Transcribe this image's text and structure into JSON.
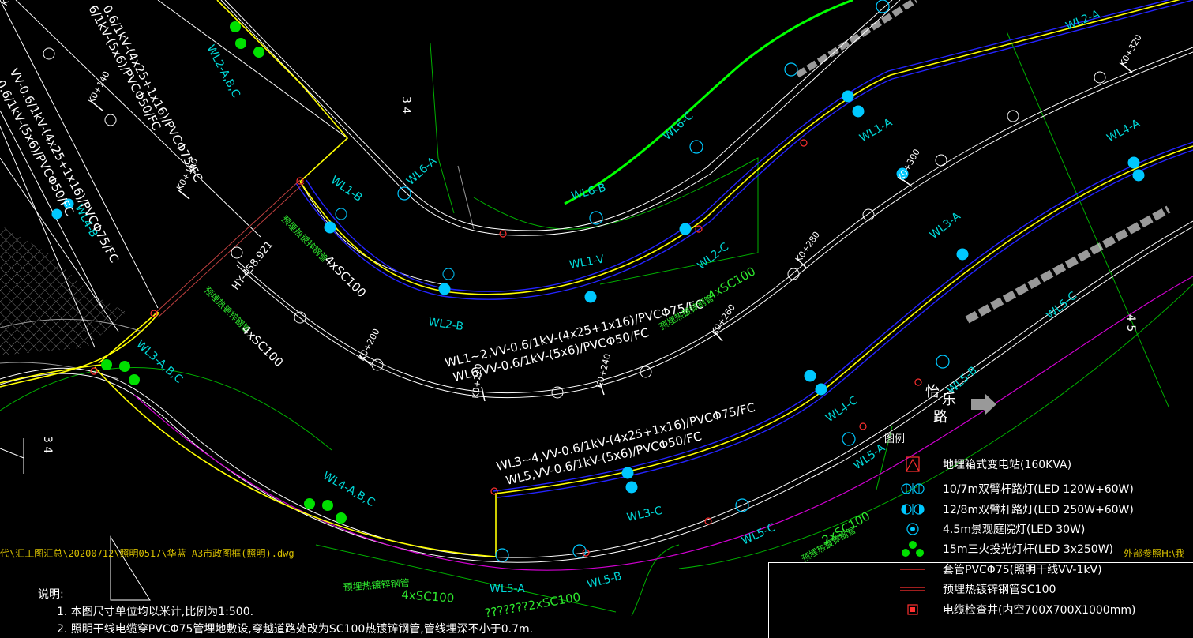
{
  "drawing": {
    "file_path": "代\\汇工图汇总\\20200712\\照明0517\\华蓝 A3市政图框(照明).dwg",
    "external_ref": "外部参照H:\\我",
    "road_name": "怡乐路",
    "road_chars": [
      "怡",
      "乐",
      "路"
    ],
    "colors": {
      "background": "#000000",
      "road_edge": "#ffffff",
      "cable_yellow": "#ffff00",
      "cable_blue": "#2020ff",
      "cable_green": "#00ff00",
      "magenta": "#d000d0",
      "label_cyan": "#00d8d8",
      "label_gold": "#d8c000",
      "boundary_green": "#00c000"
    },
    "circuit_labels": [
      "WL6-A",
      "WL6-B",
      "WL6-C",
      "WL2-A",
      "WL1-A",
      "WL4-A",
      "WL2-A,B,C",
      "WL1-B",
      "WL1-V",
      "WL2-B",
      "WL2-C",
      "WL3-A",
      "WL4-B",
      "WL3-A,B,C",
      "WL4-C",
      "WL5-B",
      "WL5-C",
      "WL4-A,B,C",
      "WL3-C",
      "WL5-A",
      "WL5-B",
      "WL5-C",
      "WL5-A"
    ],
    "cable_specs": [
      "0.6/1kV-(4x25+1x16)/PVCΦ75/FC",
      "6/1kV-(5x6)/PVCΦ50/FC",
      "VV-0.6/1kV-(4x25+1x16)/PVCΦ75/FC",
      "0.6/1kV-(5x6)/PVCΦ50/FC",
      "WL1~2,VV-0.6/1kV-(4x25+1x16)/PVCΦ75/FC",
      "WL6,VV-0.6/1kV-(5x6)/PVCΦ50/FC",
      "WL3~4,VV-0.6/1kV-(4x25+1x16)/PVCΦ75/FC",
      "WL5,VV-0.6/1kV-(5x6)/PVCΦ50/FC"
    ],
    "conduit_specs": [
      "预埋热镀锌钢管4xSC100",
      "预埋热镀锌钢管4xSC100",
      "预埋热镀锌钢管4xSC100",
      "???????2xSC100",
      "预埋热镀锌钢管2xSC100",
      "预埋热镀锌钢管2xSC100",
      "预埋热镀锌钢管4xSC100"
    ],
    "conduit_short": [
      "4xSC100",
      "4xSC100",
      "4xSC100",
      "2xSC100",
      "2xSC100",
      "4xSC100"
    ],
    "elevation": "HY-458.921",
    "lane_marks": [
      "3 4",
      "4 5",
      "3 4"
    ],
    "chainage": [
      "K0+120",
      "K0+140",
      "K0+160",
      "K0+180",
      "K0+200",
      "K0+220",
      "K0+240",
      "K0+260",
      "K0+280",
      "K0+300",
      "K0+320"
    ]
  },
  "legend": {
    "title": "图例",
    "items": [
      {
        "icon": "transformer-icon",
        "label": "地埋箱式变电站(160KVA)"
      },
      {
        "icon": "double-arm-lamp-10m-icon",
        "label": "10/7m双臂杆路灯(LED 120W+60W)"
      },
      {
        "icon": "double-arm-lamp-12m-icon",
        "label": "12/8m双臂杆路灯(LED 250W+60W)"
      },
      {
        "icon": "garden-lamp-icon",
        "label": "4.5m景观庭院灯(LED 30W)"
      },
      {
        "icon": "floodlight-pole-icon",
        "label": "15m三火投光灯杆(LED 3x250W)"
      },
      {
        "icon": "pvc-sleeve-icon",
        "label": "套管PVCΦ75(照明干线VV-1kV)"
      },
      {
        "icon": "steel-pipe-icon",
        "label": "预埋热镀锌钢管SC100"
      },
      {
        "icon": "cable-pit-icon",
        "label": "电缆检查井(内空700X700X1000mm)"
      }
    ]
  },
  "notes": {
    "title": "说明:",
    "items": [
      "1. 本图尺寸单位均以米计,比例为1:500.",
      "2. 照明干线电缆穿PVCΦ75管埋地敷设,穿越道路处改为SC100热镀锌钢管,管线埋深不小于0.7m."
    ]
  }
}
